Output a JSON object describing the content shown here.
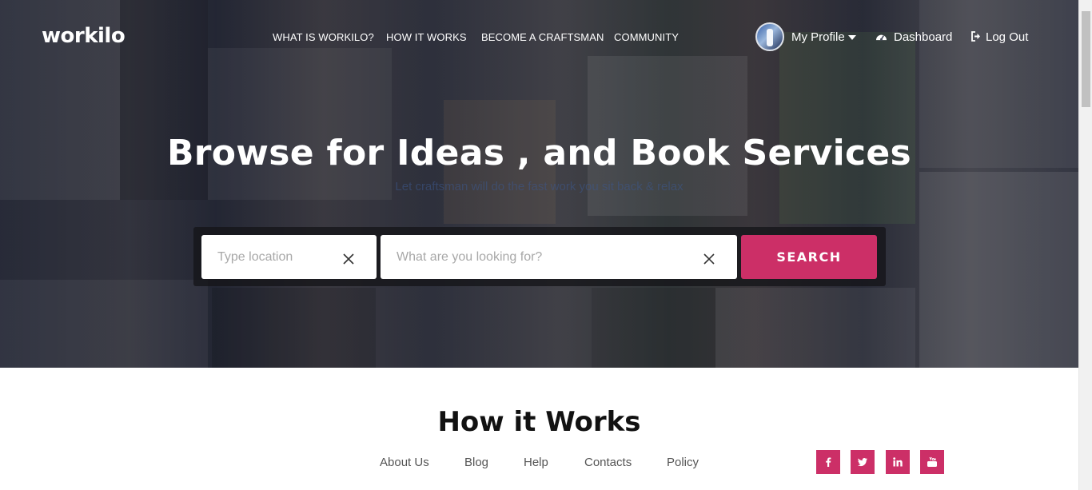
{
  "header": {
    "logo": "workilo",
    "nav": [
      {
        "label": "WHAT IS WORKILO?"
      },
      {
        "label": "HOW IT WORKS"
      },
      {
        "label": "BECOME A CRAFTSMAN"
      },
      {
        "label": "COMMUNITY"
      }
    ],
    "user": {
      "profile_label": "My Profile",
      "dashboard_label": "Dashboard",
      "logout_label": "Log Out"
    }
  },
  "hero": {
    "title": "Browse for Ideas , and Book Services",
    "subtitle": "Let craftsman will do the fast work you sit back & relax"
  },
  "search": {
    "location_placeholder": "Type location",
    "query_placeholder": "What are you looking for?",
    "button_label": "SEARCH"
  },
  "section": {
    "title": "How it Works"
  },
  "footer": {
    "links": [
      {
        "label": "About Us"
      },
      {
        "label": "Blog"
      },
      {
        "label": "Help"
      },
      {
        "label": "Contacts"
      },
      {
        "label": "Policy"
      }
    ],
    "social": [
      "facebook-icon",
      "twitter-icon",
      "linkedin-icon",
      "youtube-icon"
    ]
  },
  "colors": {
    "accent": "#cc2f67",
    "hero_overlay": "#1c1e2c"
  }
}
